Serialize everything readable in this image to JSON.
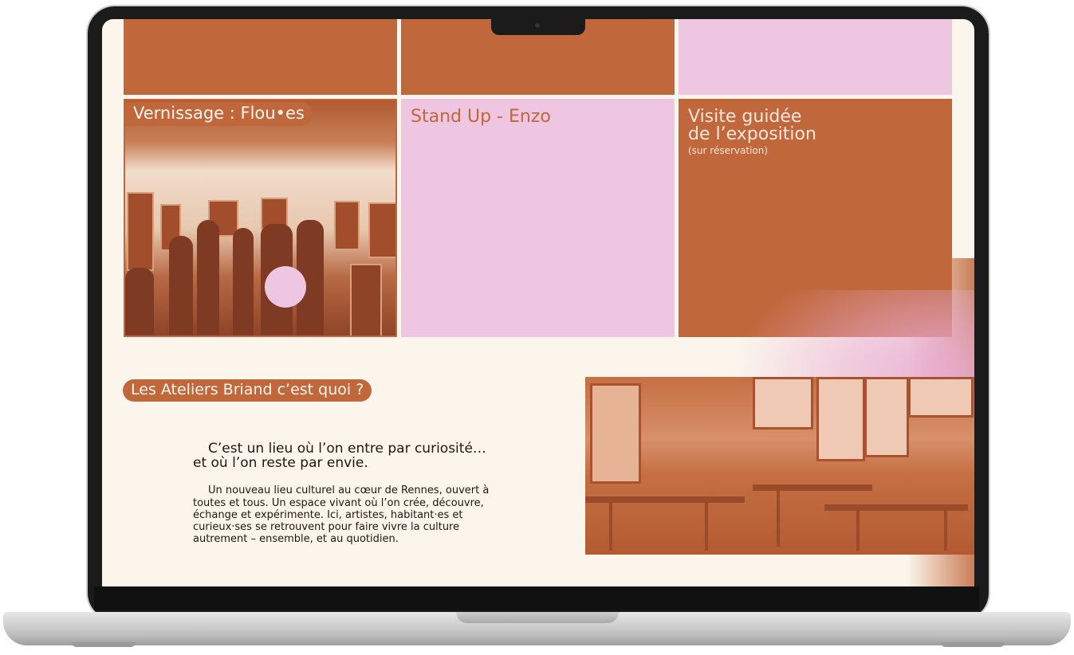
{
  "events": [
    {
      "title": "Vernissage : Flou•es"
    },
    {
      "title": "Stand Up - Enzo"
    },
    {
      "title_line1": "Visite guidée",
      "title_line2": "de l’exposition",
      "note": "(sur réservation)"
    }
  ],
  "about": {
    "heading": "Les Ateliers Briand c’est quoi ?",
    "lead_line1": "C’est un lieu où l’on entre par curiosité…",
    "lead_line2": "et où l’on reste par envie.",
    "body_line1": "Un nouveau lieu culturel au cœur de Rennes, ouvert à",
    "body_line2": "toutes et tous. Un espace vivant où l’on crée, découvre,",
    "body_line3": "échange et expérimente. Ici, artistes, habitant·es et",
    "body_line4": "curieux·ses se retrouvent pour faire vivre la culture",
    "body_line5": "autrement – ensemble, et au quotidien."
  },
  "colors": {
    "rust": "#c0673b",
    "pink": "#efc6e2",
    "cream": "#fbf5ec",
    "text": "#1f1712"
  }
}
